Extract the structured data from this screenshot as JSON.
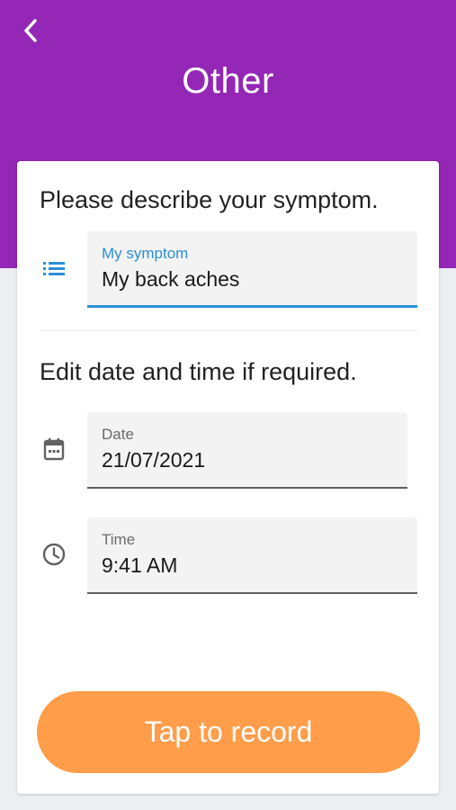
{
  "header": {
    "title": "Other",
    "back_icon": "chevron-left-icon",
    "background_color": "#9427b5"
  },
  "symptom_section": {
    "prompt": "Please describe your symptom.",
    "icon": "list-icon",
    "field": {
      "label": "My symptom",
      "value": "My back aches"
    }
  },
  "datetime_section": {
    "prompt": "Edit date and time if required.",
    "date": {
      "icon": "calendar-icon",
      "label": "Date",
      "value": "21/07/2021"
    },
    "time": {
      "icon": "clock-icon",
      "label": "Time",
      "value": "9:41 AM"
    }
  },
  "record_button": {
    "label": "Tap to record",
    "color": "#ff9d4a"
  },
  "accent_color": "#2b8fd6"
}
